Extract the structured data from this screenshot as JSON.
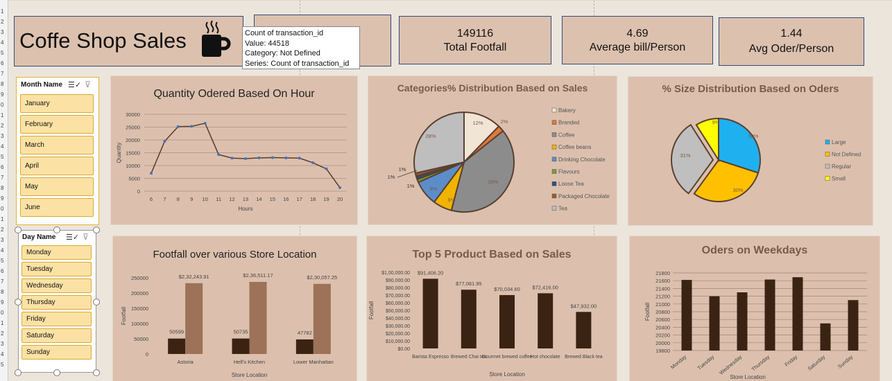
{
  "title": "Coffe Shop Sales",
  "row_numbers": [
    "1",
    "2",
    "3",
    "4",
    "5",
    "6",
    "7",
    "8",
    "9",
    "0",
    "1",
    "2",
    "3",
    "4",
    "5",
    "6",
    "7",
    "8",
    "9",
    "0",
    "1",
    "2",
    "3",
    "4",
    "5",
    "6",
    "7",
    "8",
    "9",
    "0",
    "1",
    "2",
    "3",
    "4",
    "5"
  ],
  "tooltip": {
    "line1": "Count of transaction_id",
    "line2": "Value: 44518",
    "line3": "Category: Not Defined",
    "line4": "Series: Count of transaction_id"
  },
  "kpis": [
    {
      "value": "149116",
      "label": "Total Footfall"
    },
    {
      "value": "4.69",
      "label": "Average bill/Person"
    },
    {
      "value": "1.44",
      "label": "Avg Oder/Person"
    }
  ],
  "slicer_month": {
    "title": "Month Name",
    "items": [
      "January",
      "February",
      "March",
      "April",
      "May",
      "June"
    ]
  },
  "slicer_day": {
    "title": "Day Name",
    "items": [
      "Monday",
      "Tuesday",
      "Wednesday",
      "Thursday",
      "Friday",
      "Saturday",
      "Sunday"
    ]
  },
  "colors": {
    "accent_dark": "#3b2314",
    "accent_light": "#9c7258",
    "line": "#5a3a28",
    "marker": "#4472c4",
    "panel_bg": "#dcc0ad"
  },
  "chart_data": [
    {
      "type": "line",
      "title": "Quantity Odered Based On Hour",
      "xlabel": "Hours",
      "ylabel": "Quantity",
      "x": [
        6,
        7,
        8,
        9,
        10,
        11,
        12,
        13,
        14,
        15,
        16,
        17,
        18,
        19,
        20
      ],
      "values": [
        7000,
        19500,
        25200,
        25300,
        26500,
        14300,
        12900,
        12700,
        13000,
        13100,
        13000,
        12900,
        11100,
        8700,
        1400
      ],
      "ylim": [
        0,
        30000
      ],
      "yticks": [
        "0",
        "5000",
        "10000",
        "15000",
        "20000",
        "25000",
        "30000"
      ]
    },
    {
      "type": "pie",
      "title": "Categories% Distribution Based on Sales",
      "legend": [
        "Bakery",
        "Branded",
        "Coffee",
        "Coffee beans",
        "Drinking Chocolate",
        "Flavours",
        "Loose Tea",
        "Packaged Chocolate",
        "Tea"
      ],
      "values": [
        12,
        2,
        39,
        6,
        8,
        1,
        1,
        1,
        28
      ],
      "colors": [
        "#f1e5d6",
        "#e0783a",
        "#8c8c8c",
        "#f0b400",
        "#5b8ec9",
        "#7b9a3a",
        "#2d4f7a",
        "#9b5b2e",
        "#bebebe"
      ],
      "labels": [
        "12%",
        "2%",
        "39%",
        "6%",
        "8%",
        "1%",
        "1%",
        "1%",
        "28%"
      ],
      "legend_position": "right"
    },
    {
      "type": "pie",
      "title": "% Size Distribution Based on Oders",
      "legend": [
        "Large",
        "Not Defined",
        "Regular",
        "Small"
      ],
      "values": [
        30,
        30,
        31,
        9
      ],
      "colors": [
        "#1fb0f0",
        "#ffc000",
        "#bfbfbf",
        "#ffff00"
      ],
      "labels": [
        "30%",
        "30%",
        "31%",
        "9%"
      ],
      "legend_position": "right"
    },
    {
      "type": "bar",
      "title": "Footfall over various Store Location",
      "xlabel": "Store Location",
      "ylabel": "Footfall",
      "categories": [
        "Astoria",
        "Hell's Kitchen",
        "Lower Manhattan"
      ],
      "series": [
        {
          "values": [
            50599,
            50735,
            47782
          ],
          "labels": [
            "50599",
            "50735",
            "47782"
          ]
        },
        {
          "values": [
            232243.91,
            236511.17,
            230057.25
          ],
          "labels": [
            "$2,32,243.91",
            "$2,36,511.17",
            "$2,30,057.25"
          ]
        }
      ],
      "ylim": [
        0,
        250000
      ],
      "yticks": [
        "0",
        "50000",
        "100000",
        "150000",
        "200000",
        "250000"
      ]
    },
    {
      "type": "bar",
      "title": "Top 5 Product Based on Sales",
      "xlabel": "Store Location",
      "ylabel": "Footfall",
      "categories": [
        "Barista Espresso",
        "Brewed Chai tea",
        "Gourmet brewed coffee",
        "Hot chocolate",
        "Brewed Black tea"
      ],
      "values": [
        91406.2,
        77081.95,
        70034.6,
        72416.0,
        47932.0
      ],
      "labels": [
        "$91,406.20",
        "$77,081.95",
        "$70,034.60",
        "$72,416.00",
        "$47,932.00"
      ],
      "ylim": [
        0,
        100000
      ],
      "yticks": [
        "$0.00",
        "$10,000.00",
        "$20,000.00",
        "$30,000.00",
        "$40,000.00",
        "$50,000.00",
        "$60,000.00",
        "$70,000.00",
        "$80,000.00",
        "$90,000.00",
        "$1,00,000.00"
      ]
    },
    {
      "type": "bar",
      "title": "Oders on Weekdays",
      "xlabel": "Store Location",
      "ylabel": "Footfall",
      "categories": [
        "Monday",
        "Tuesday",
        "Wednesday",
        "Thursday",
        "Friday",
        "Saturday",
        "Sunday"
      ],
      "values": [
        21620,
        21200,
        21300,
        21630,
        21690,
        20500,
        21100
      ],
      "ylim": [
        19800,
        21800
      ],
      "yticks": [
        "19800",
        "20000",
        "20200",
        "20400",
        "20600",
        "20800",
        "21000",
        "21200",
        "21400",
        "21600",
        "21800"
      ]
    }
  ]
}
